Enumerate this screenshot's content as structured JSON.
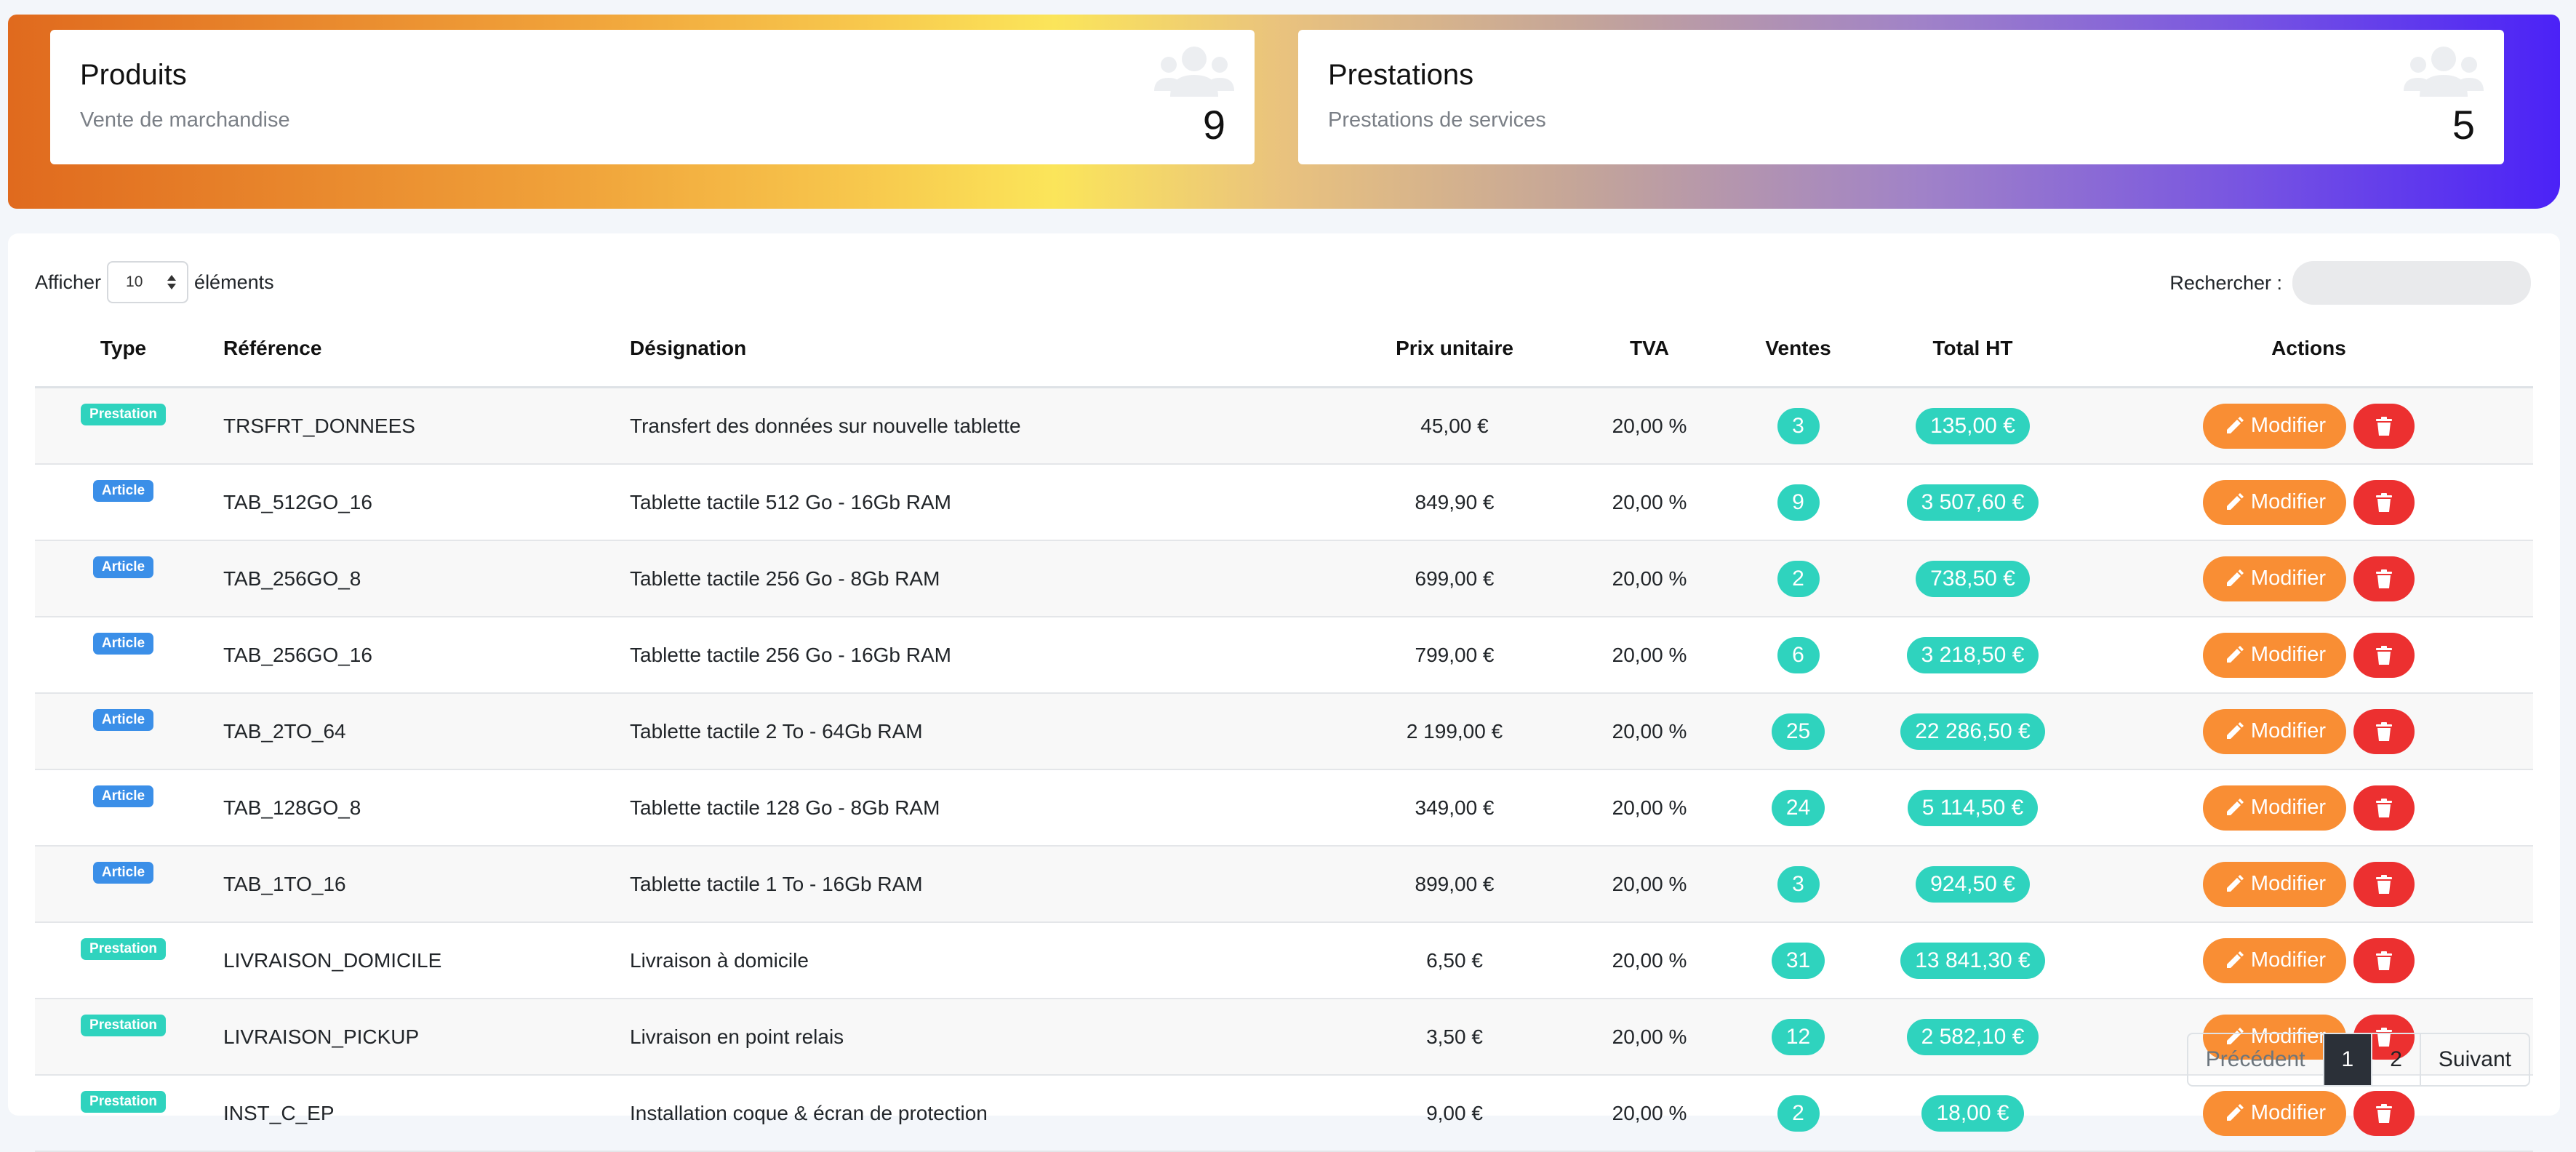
{
  "colors": {
    "prestation_badge": "#2fd3be",
    "article_badge": "#3b8fe8",
    "pill": "#2fd3be",
    "edit_button": "#f98e34",
    "delete_button": "#ec3030"
  },
  "stats": [
    {
      "title": "Produits",
      "subtitle": "Vente de marchandise",
      "count": "9",
      "icon": "users-icon"
    },
    {
      "title": "Prestations",
      "subtitle": "Prestations de services",
      "count": "5",
      "icon": "users-icon"
    }
  ],
  "table_controls": {
    "show_label": "Afficher",
    "page_length": "10",
    "elements_label": "éléments",
    "search_label": "Rechercher :",
    "search_value": ""
  },
  "columns": [
    "Type",
    "Référence",
    "Désignation",
    "Prix unitaire",
    "TVA",
    "Ventes",
    "Total HT",
    "Actions"
  ],
  "rows": [
    {
      "type": "Prestation",
      "ref": "TRSFRT_DONNEES",
      "designation": "Transfert des données sur nouvelle tablette",
      "price": "45,00 €",
      "tva": "20,00 %",
      "sales": "3",
      "total": "135,00 €"
    },
    {
      "type": "Article",
      "ref": "TAB_512GO_16",
      "designation": "Tablette tactile 512 Go - 16Gb RAM",
      "price": "849,90 €",
      "tva": "20,00 %",
      "sales": "9",
      "total": "3 507,60 €"
    },
    {
      "type": "Article",
      "ref": "TAB_256GO_8",
      "designation": "Tablette tactile 256 Go - 8Gb RAM",
      "price": "699,00 €",
      "tva": "20,00 %",
      "sales": "2",
      "total": "738,50 €"
    },
    {
      "type": "Article",
      "ref": "TAB_256GO_16",
      "designation": "Tablette tactile 256 Go - 16Gb RAM",
      "price": "799,00 €",
      "tva": "20,00 %",
      "sales": "6",
      "total": "3 218,50 €"
    },
    {
      "type": "Article",
      "ref": "TAB_2TO_64",
      "designation": "Tablette tactile 2 To - 64Gb RAM",
      "price": "2 199,00 €",
      "tva": "20,00 %",
      "sales": "25",
      "total": "22 286,50 €"
    },
    {
      "type": "Article",
      "ref": "TAB_128GO_8",
      "designation": "Tablette tactile 128 Go - 8Gb RAM",
      "price": "349,00 €",
      "tva": "20,00 %",
      "sales": "24",
      "total": "5 114,50 €"
    },
    {
      "type": "Article",
      "ref": "TAB_1TO_16",
      "designation": "Tablette tactile 1 To - 16Gb RAM",
      "price": "899,00 €",
      "tva": "20,00 %",
      "sales": "3",
      "total": "924,50 €"
    },
    {
      "type": "Prestation",
      "ref": "LIVRAISON_DOMICILE",
      "designation": "Livraison à domicile",
      "price": "6,50 €",
      "tva": "20,00 %",
      "sales": "31",
      "total": "13 841,30 €"
    },
    {
      "type": "Prestation",
      "ref": "LIVRAISON_PICKUP",
      "designation": "Livraison en point relais",
      "price": "3,50 €",
      "tva": "20,00 %",
      "sales": "12",
      "total": "2 582,10 €"
    },
    {
      "type": "Prestation",
      "ref": "INST_C_EP",
      "designation": "Installation coque & écran de protection",
      "price": "9,00 €",
      "tva": "20,00 %",
      "sales": "2",
      "total": "18,00 €"
    }
  ],
  "actions": {
    "edit_label": "Modifier",
    "edit_icon": "pencil-icon",
    "delete_icon": "trash-icon"
  },
  "pagination": {
    "prev": "Précédent",
    "pages": [
      "1",
      "2"
    ],
    "current": "1",
    "next": "Suivant"
  }
}
